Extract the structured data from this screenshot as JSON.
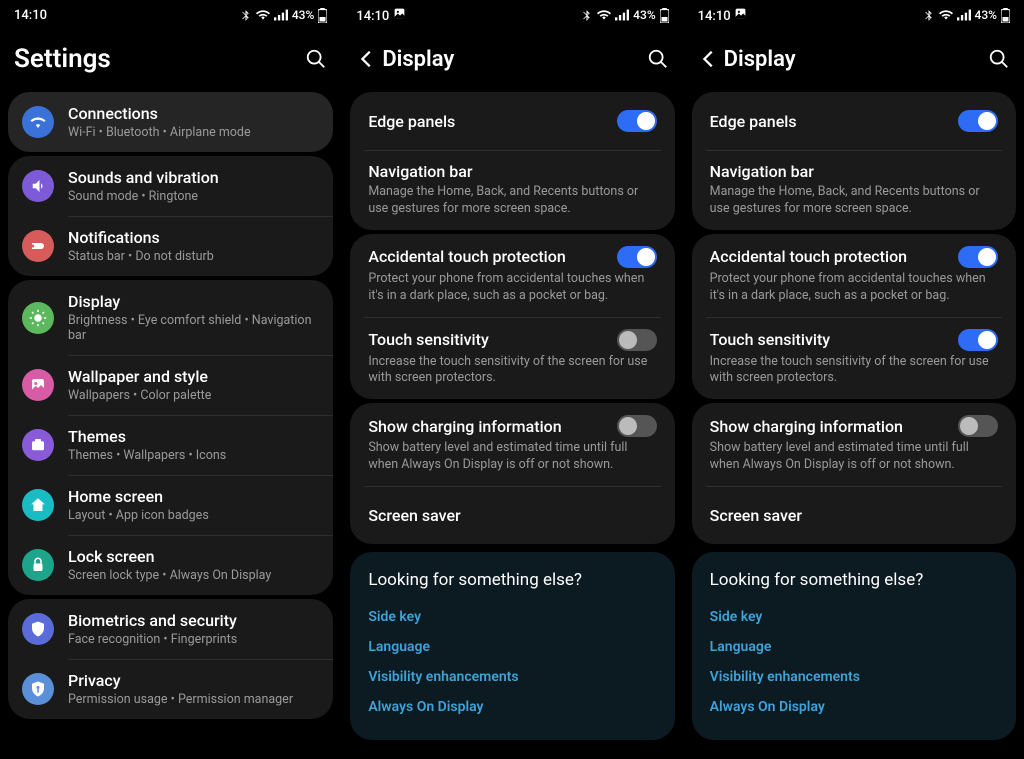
{
  "status": {
    "time": "14:10",
    "battery": "43%"
  },
  "panel1": {
    "title": "Settings",
    "items": [
      {
        "label": "Connections",
        "sub": "Wi-Fi  •  Bluetooth  •  Airplane mode",
        "color": "#3a72d8"
      },
      {
        "label": "Sounds and vibration",
        "sub": "Sound mode  •  Ringtone",
        "color": "#7d5bd8"
      },
      {
        "label": "Notifications",
        "sub": "Status bar  •  Do not disturb",
        "color": "#d85b5b"
      },
      {
        "label": "Display",
        "sub": "Brightness  •  Eye comfort shield  •  Navigation bar",
        "color": "#5cb85c"
      },
      {
        "label": "Wallpaper and style",
        "sub": "Wallpapers  •  Color palette",
        "color": "#d85ba5"
      },
      {
        "label": "Themes",
        "sub": "Themes  •  Wallpapers  •  Icons",
        "color": "#8a5bd8"
      },
      {
        "label": "Home screen",
        "sub": "Layout  •  App icon badges",
        "color": "#1abcc4"
      },
      {
        "label": "Lock screen",
        "sub": "Screen lock type  •  Always On Display",
        "color": "#1ca58a"
      },
      {
        "label": "Biometrics and security",
        "sub": "Face recognition  •  Fingerprints",
        "color": "#5b6bd8"
      },
      {
        "label": "Privacy",
        "sub": "Permission usage  •  Permission manager",
        "color": "#5b8fd8"
      }
    ]
  },
  "panel2": {
    "title": "Display",
    "items": {
      "edge": {
        "label": "Edge panels",
        "on": true
      },
      "nav": {
        "label": "Navigation bar",
        "sub": "Manage the Home, Back, and Recents buttons or use gestures for more screen space."
      },
      "atp": {
        "label": "Accidental touch protection",
        "sub": "Protect your phone from accidental touches when it's in a dark place, such as a pocket or bag.",
        "on": true
      },
      "ts": {
        "label": "Touch sensitivity",
        "sub": "Increase the touch sensitivity of the screen for use with screen protectors.",
        "on": false
      },
      "charge": {
        "label": "Show charging information",
        "sub": "Show battery level and estimated time until full when Always On Display is off or not shown.",
        "on": false
      },
      "ss": {
        "label": "Screen saver"
      }
    },
    "lookfor": {
      "title": "Looking for something else?",
      "links": [
        "Side key",
        "Language",
        "Visibility enhancements",
        "Always On Display"
      ]
    }
  },
  "panel3": {
    "title": "Display",
    "items": {
      "edge": {
        "label": "Edge panels",
        "on": true
      },
      "nav": {
        "label": "Navigation bar",
        "sub": "Manage the Home, Back, and Recents buttons or use gestures for more screen space."
      },
      "atp": {
        "label": "Accidental touch protection",
        "sub": "Protect your phone from accidental touches when it's in a dark place, such as a pocket or bag.",
        "on": true
      },
      "ts": {
        "label": "Touch sensitivity",
        "sub": "Increase the touch sensitivity of the screen for use with screen protectors.",
        "on": true
      },
      "charge": {
        "label": "Show charging information",
        "sub": "Show battery level and estimated time until full when Always On Display is off or not shown.",
        "on": false
      },
      "ss": {
        "label": "Screen saver"
      }
    },
    "lookfor": {
      "title": "Looking for something else?",
      "links": [
        "Side key",
        "Language",
        "Visibility enhancements",
        "Always On Display"
      ]
    }
  }
}
